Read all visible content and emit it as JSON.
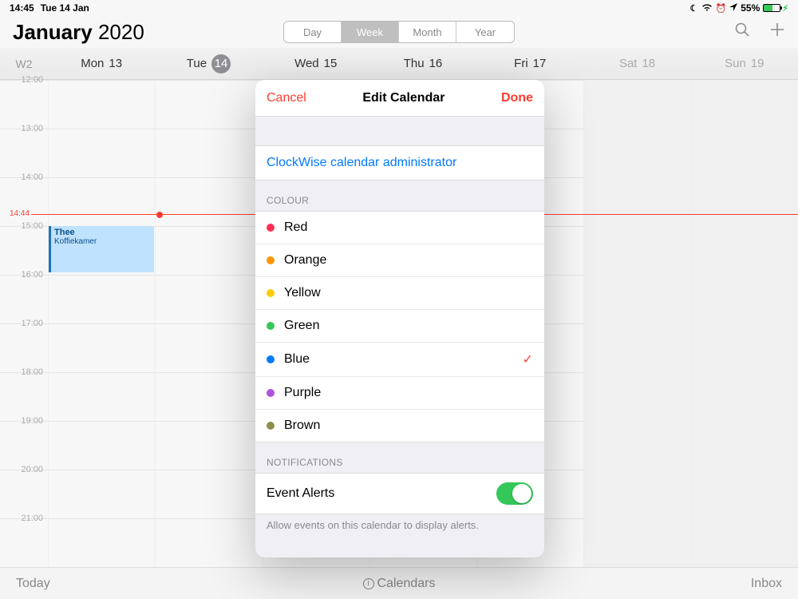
{
  "statusbar": {
    "time": "14:45",
    "date": "Tue 14 Jan",
    "battery_pct": "55%"
  },
  "header": {
    "month_bold": "January",
    "year": "2020",
    "views": {
      "day": "Day",
      "week": "Week",
      "month": "Month",
      "year": "Year"
    }
  },
  "dayrow": {
    "week_label": "W2",
    "days": {
      "mon": {
        "name": "Mon",
        "num": "13"
      },
      "tue": {
        "name": "Tue",
        "num": "14"
      },
      "wed": {
        "name": "Wed",
        "num": "15"
      },
      "thu": {
        "name": "Thu",
        "num": "16"
      },
      "fri": {
        "name": "Fri",
        "num": "17"
      },
      "sat": {
        "name": "Sat",
        "num": "18"
      },
      "sun": {
        "name": "Sun",
        "num": "19"
      }
    }
  },
  "grid": {
    "now_label": "14:44",
    "hours": {
      "h12": "12:00",
      "h13": "13:00",
      "h14": "14:00",
      "h15": "15:00",
      "h16": "16:00",
      "h17": "17:00",
      "h18": "18:00",
      "h19": "19:00",
      "h20": "20:00",
      "h21": "21:00"
    },
    "event": {
      "title": "Thee",
      "location": "Koffiekamer"
    }
  },
  "toolbar": {
    "today": "Today",
    "calendars": "Calendars",
    "inbox": "Inbox"
  },
  "popover": {
    "cancel": "Cancel",
    "title": "Edit Calendar",
    "done": "Done",
    "calendar_name": "ClockWise calendar administrator",
    "colour_label": "COLOUR",
    "colours": {
      "red": "Red",
      "orange": "Orange",
      "yellow": "Yellow",
      "green": "Green",
      "blue": "Blue",
      "purple": "Purple",
      "brown": "Brown"
    },
    "selected_colour": "blue",
    "notifications_label": "NOTIFICATIONS",
    "event_alerts": "Event Alerts",
    "footnote": "Allow events on this calendar to display alerts."
  }
}
